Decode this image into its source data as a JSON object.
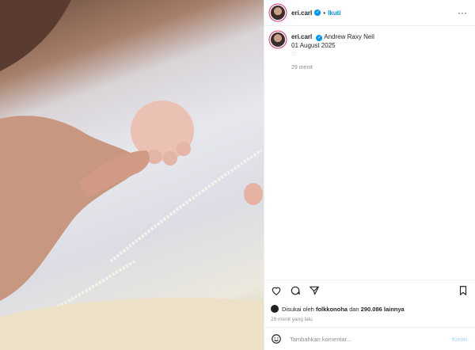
{
  "header": {
    "username": "eri.carl",
    "separator": "•",
    "follow_label": "Ikuti",
    "more_label": "···"
  },
  "caption": {
    "username": "eri.carl",
    "text": "Andrew Raxy Neil",
    "line2": "01 August 2025",
    "emoji": "♡",
    "time": "29 menit"
  },
  "likes": {
    "prefix": "Disukai oleh",
    "user": "folkkonoha",
    "joiner": "dan",
    "count": "290.086 lainnya"
  },
  "posted": "29 menit yang lalu",
  "composer": {
    "placeholder": "Tambahkan komentar...",
    "send_label": "Kirim"
  },
  "colors": {
    "accent": "#0095f6",
    "ring": "#e1306c"
  },
  "icons": [
    "heart-icon",
    "comment-icon",
    "share-icon",
    "bookmark-icon",
    "emoji-icon",
    "verified-icon",
    "more-icon"
  ]
}
